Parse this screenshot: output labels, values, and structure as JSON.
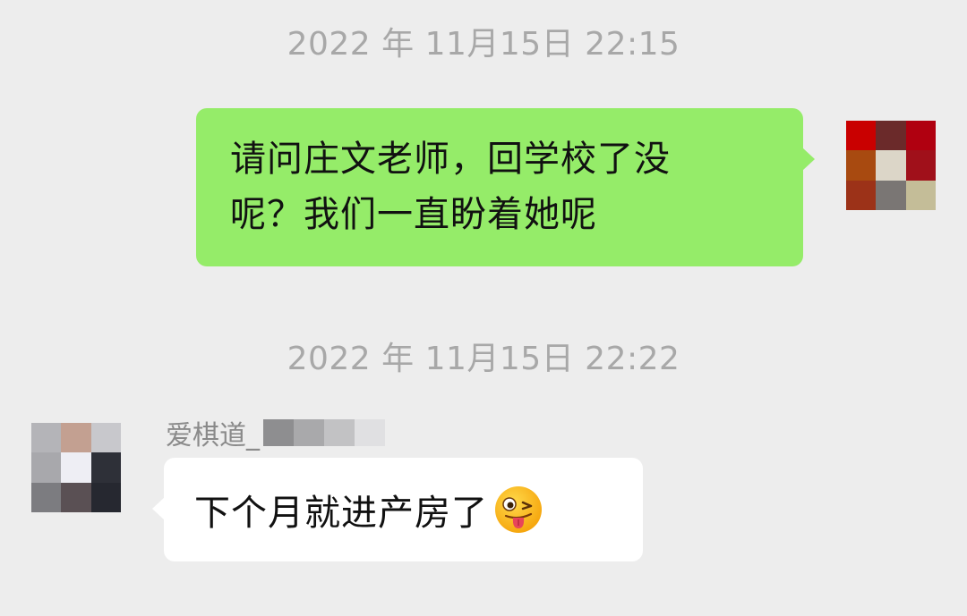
{
  "messages": [
    {
      "timestamp": "2022 年 11月15日 22:15",
      "direction": "outgoing",
      "lines": [
        "请问庄文老师，回学校了没",
        "呢？我们一直盼着她呢"
      ],
      "bubble_color": "#95ec69",
      "avatar_colors": [
        "#c90000",
        "#6b2a2a",
        "#b00010",
        "#a84a10",
        "#dcd6c8",
        "#a0101a",
        "#9c3218",
        "#7a7674",
        "#c4bd98"
      ]
    },
    {
      "timestamp": "2022 年 11月15日 22:22",
      "direction": "incoming",
      "sender": "爱棋道_",
      "text": "下个月就进产房了",
      "emoji": "winking-face-with-tongue-icon",
      "bubble_color": "#ffffff",
      "avatar_colors": [
        "#b4b4b8",
        "#c3a091",
        "#c8c8cc",
        "#a8a8ac",
        "#eeeef4",
        "#2e3038",
        "#7c7c80",
        "#5a5054",
        "#262830"
      ]
    }
  ],
  "colors": {
    "background": "#ededed",
    "timestamp_text": "#a8a8a8"
  }
}
